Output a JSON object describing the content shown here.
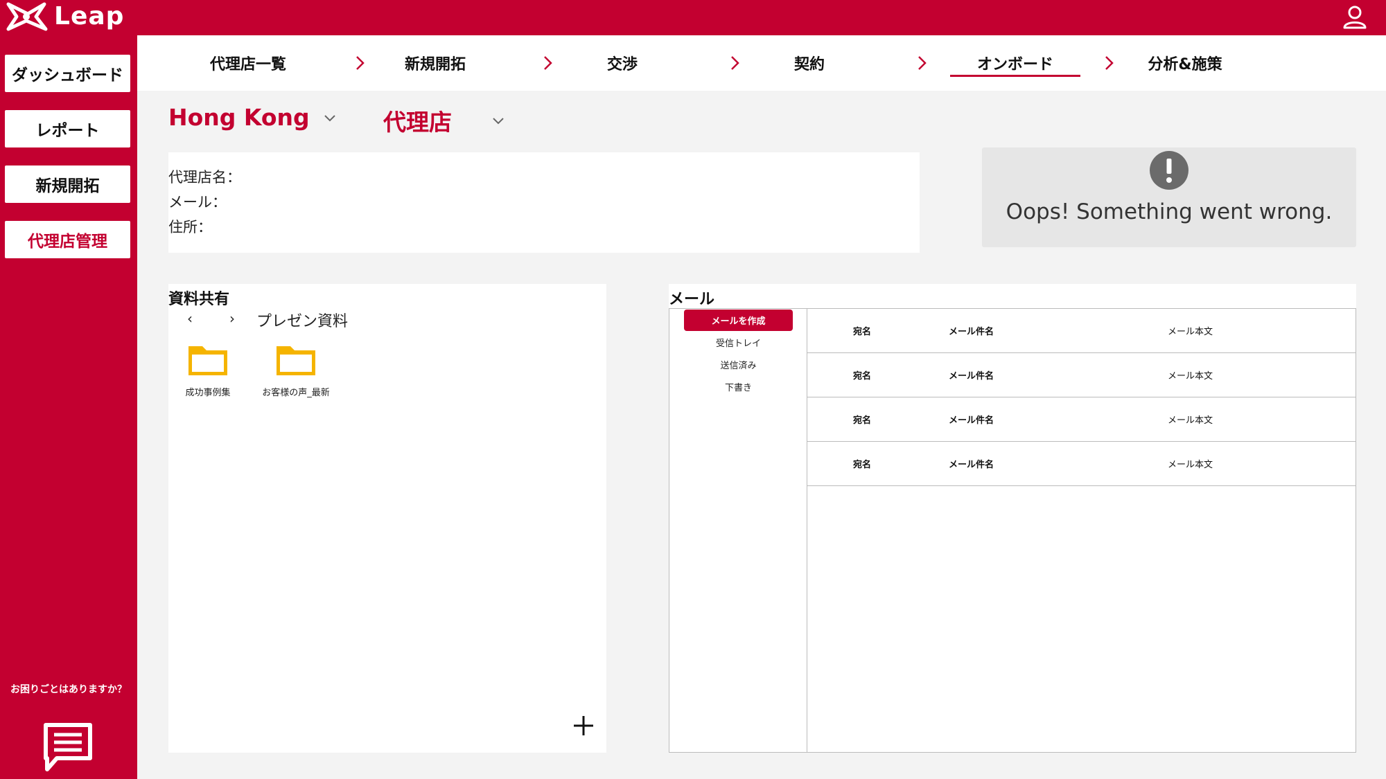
{
  "app": {
    "name": "Leap"
  },
  "sidebar": {
    "items": [
      {
        "label": "ダッシュボード"
      },
      {
        "label": "レポート"
      },
      {
        "label": "新規開拓"
      },
      {
        "label": "代理店管理"
      }
    ],
    "active_item": "代理店管理",
    "help_text": "お困りごとはありますか？"
  },
  "stepper": {
    "steps": [
      {
        "label": "代理店一覧"
      },
      {
        "label": "新規開拓"
      },
      {
        "label": "交渉"
      },
      {
        "label": "契約"
      },
      {
        "label": "オンボード"
      },
      {
        "label": "分析&施策"
      }
    ],
    "active_step": "オンボード"
  },
  "filters": {
    "region": "Hong Kong",
    "agency": "代理店"
  },
  "agency_info": {
    "name_label": "代理店名：",
    "email_label": "メール：",
    "address_label": "住所："
  },
  "error_card": {
    "message": "Oops! Something went wrong."
  },
  "files": {
    "title": "資料共有",
    "prev_arrow": "‹",
    "next_arrow": "›",
    "path": "プレゼン資料",
    "folders": [
      {
        "name": "成功事例集"
      },
      {
        "name": "お客様の声_最新"
      }
    ]
  },
  "mail": {
    "title": "メール",
    "compose_label": "メールを作成",
    "folders": [
      {
        "label": "受信トレイ"
      },
      {
        "label": "送信済み"
      },
      {
        "label": "下書き"
      }
    ],
    "rows": [
      {
        "recipient": "宛名",
        "subject": "メール件名",
        "body": "メール本文"
      },
      {
        "recipient": "宛名",
        "subject": "メール件名",
        "body": "メール本文"
      },
      {
        "recipient": "宛名",
        "subject": "メール件名",
        "body": "メール本文"
      },
      {
        "recipient": "宛名",
        "subject": "メール件名",
        "body": "メール本文"
      }
    ]
  },
  "colors": {
    "brand": "#c30030",
    "folder": "#f5b400"
  }
}
